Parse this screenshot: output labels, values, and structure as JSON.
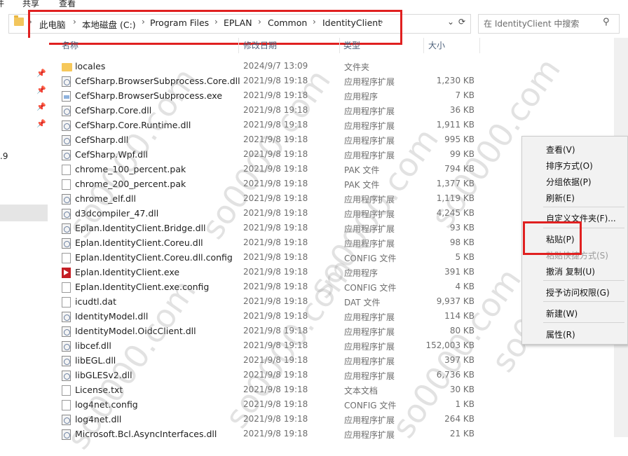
{
  "ribbon": {
    "tabs": [
      "件",
      "共享",
      "查看"
    ]
  },
  "address": {
    "crumbs": [
      "此电脑",
      "本地磁盘 (C:)",
      "Program Files",
      "EPLAN",
      "Common",
      "IdentityClient"
    ],
    "search_placeholder": "在 IdentityClient 中搜索"
  },
  "nav": {
    "partial_text": ".9"
  },
  "columns": {
    "name": "名称",
    "date": "修改日期",
    "type": "类型",
    "size": "大小"
  },
  "files": [
    {
      "name": "locales",
      "date": "2024/9/7 13:09",
      "type": "文件夹",
      "size": "",
      "icon": "folder-icon"
    },
    {
      "name": "CefSharp.BrowserSubprocess.Core.dll",
      "date": "2021/9/8 19:18",
      "type": "应用程序扩展",
      "size": "1,230 KB",
      "icon": "dll-icon"
    },
    {
      "name": "CefSharp.BrowserSubprocess.exe",
      "date": "2021/9/8 19:18",
      "type": "应用程序",
      "size": "7 KB",
      "icon": "exe-icon"
    },
    {
      "name": "CefSharp.Core.dll",
      "date": "2021/9/8 19:18",
      "type": "应用程序扩展",
      "size": "36 KB",
      "icon": "dll-icon"
    },
    {
      "name": "CefSharp.Core.Runtime.dll",
      "date": "2021/9/8 19:18",
      "type": "应用程序扩展",
      "size": "1,911 KB",
      "icon": "dll-icon"
    },
    {
      "name": "CefSharp.dll",
      "date": "2021/9/8 19:18",
      "type": "应用程序扩展",
      "size": "995 KB",
      "icon": "dll-icon"
    },
    {
      "name": "CefSharp.Wpf.dll",
      "date": "2021/9/8 19:18",
      "type": "应用程序扩展",
      "size": "99 KB",
      "icon": "dll-icon"
    },
    {
      "name": "chrome_100_percent.pak",
      "date": "2021/9/8 19:18",
      "type": "PAK 文件",
      "size": "794 KB",
      "icon": "file-icon"
    },
    {
      "name": "chrome_200_percent.pak",
      "date": "2021/9/8 19:18",
      "type": "PAK 文件",
      "size": "1,377 KB",
      "icon": "file-icon"
    },
    {
      "name": "chrome_elf.dll",
      "date": "2021/9/8 19:18",
      "type": "应用程序扩展",
      "size": "1,119 KB",
      "icon": "dll-icon"
    },
    {
      "name": "d3dcompiler_47.dll",
      "date": "2021/9/8 19:18",
      "type": "应用程序扩展",
      "size": "4,245 KB",
      "icon": "dll-icon"
    },
    {
      "name": "Eplan.IdentityClient.Bridge.dll",
      "date": "2021/9/8 19:18",
      "type": "应用程序扩展",
      "size": "93 KB",
      "icon": "dll-icon"
    },
    {
      "name": "Eplan.IdentityClient.Coreu.dll",
      "date": "2021/9/8 19:18",
      "type": "应用程序扩展",
      "size": "98 KB",
      "icon": "dll-icon"
    },
    {
      "name": "Eplan.IdentityClient.Coreu.dll.config",
      "date": "2021/9/8 19:18",
      "type": "CONFIG 文件",
      "size": "5 KB",
      "icon": "file-icon"
    },
    {
      "name": "Eplan.IdentityClient.exe",
      "date": "2021/9/8 19:18",
      "type": "应用程序",
      "size": "391 KB",
      "icon": "eplan-icon"
    },
    {
      "name": "Eplan.IdentityClient.exe.config",
      "date": "2021/9/8 19:18",
      "type": "CONFIG 文件",
      "size": "4 KB",
      "icon": "file-icon"
    },
    {
      "name": "icudtl.dat",
      "date": "2021/9/8 19:18",
      "type": "DAT 文件",
      "size": "9,937 KB",
      "icon": "file-icon"
    },
    {
      "name": "IdentityModel.dll",
      "date": "2021/9/8 19:18",
      "type": "应用程序扩展",
      "size": "114 KB",
      "icon": "dll-icon"
    },
    {
      "name": "IdentityModel.OidcClient.dll",
      "date": "2021/9/8 19:18",
      "type": "应用程序扩展",
      "size": "80 KB",
      "icon": "dll-icon"
    },
    {
      "name": "libcef.dll",
      "date": "2021/9/8 19:18",
      "type": "应用程序扩展",
      "size": "152,003 KB",
      "icon": "dll-icon"
    },
    {
      "name": "libEGL.dll",
      "date": "2021/9/8 19:18",
      "type": "应用程序扩展",
      "size": "397 KB",
      "icon": "dll-icon"
    },
    {
      "name": "libGLESv2.dll",
      "date": "2021/9/8 19:18",
      "type": "应用程序扩展",
      "size": "6,736 KB",
      "icon": "dll-icon"
    },
    {
      "name": "License.txt",
      "date": "2021/9/8 19:18",
      "type": "文本文档",
      "size": "30 KB",
      "icon": "file-icon"
    },
    {
      "name": "log4net.config",
      "date": "2021/9/8 19:18",
      "type": "CONFIG 文件",
      "size": "1 KB",
      "icon": "file-icon"
    },
    {
      "name": "log4net.dll",
      "date": "2021/9/8 19:18",
      "type": "应用程序扩展",
      "size": "264 KB",
      "icon": "dll-icon"
    },
    {
      "name": "Microsoft.Bcl.AsyncInterfaces.dll",
      "date": "2021/9/8 19:18",
      "type": "应用程序扩展",
      "size": "21 KB",
      "icon": "dll-icon"
    }
  ],
  "context_menu": {
    "view": "查看(V)",
    "sort": "排序方式(O)",
    "group": "分组依据(P)",
    "refresh": "刷新(E)",
    "customize": "自定义文件夹(F)...",
    "paste": "粘贴(P)",
    "paste_shortcut": "粘贴快捷方式(S)",
    "undo_copy": "撤消 复制(U)",
    "grant_access": "授予访问权限(G)",
    "new": "新建(W)",
    "properties": "属性(R)"
  },
  "watermark": "so0000.com",
  "colors": {
    "highlight_box": "#e02020",
    "eplan_icon": "#c41e25",
    "folder": "#f6c85a"
  }
}
